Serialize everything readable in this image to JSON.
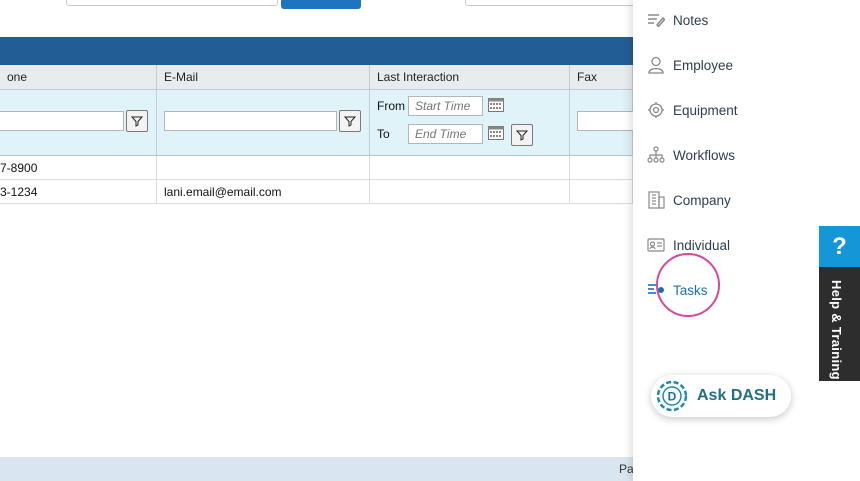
{
  "grid": {
    "headers": [
      "one",
      "E-Mail",
      "Last Interaction",
      "Fax"
    ],
    "filter": {
      "from_label": "From",
      "to_label": "To",
      "start_placeholder": "Start Time",
      "end_placeholder": "End Time"
    },
    "rows": [
      [
        "7-8900",
        "",
        "",
        ""
      ],
      [
        "3-1234",
        "lani.email@email.com",
        "",
        ""
      ]
    ]
  },
  "footer": {
    "text": "Pa"
  },
  "side_panel": {
    "items": [
      {
        "label": "Notes",
        "icon": "notes-icon"
      },
      {
        "label": "Employee",
        "icon": "employee-icon"
      },
      {
        "label": "Equipment",
        "icon": "equipment-icon"
      },
      {
        "label": "Workflows",
        "icon": "workflows-icon"
      },
      {
        "label": "Company",
        "icon": "company-icon"
      },
      {
        "label": "Individual",
        "icon": "individual-icon"
      },
      {
        "label": "Tasks",
        "icon": "tasks-icon",
        "active": true
      }
    ],
    "ask_dash": {
      "label_prefix": "Ask",
      "label_brand": "DASH"
    }
  },
  "help_tab": {
    "symbol": "?",
    "label": "Help & Training"
  },
  "colors": {
    "header_bar": "#235d96",
    "filter_row": "#dff3f8",
    "accent": "#1c6fb5",
    "highlight_ring": "#d7479b",
    "help_blue": "#1596d6"
  }
}
